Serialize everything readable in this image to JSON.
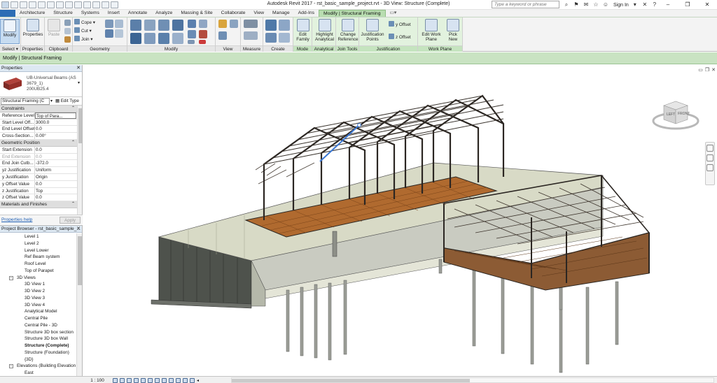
{
  "title_bar": {
    "title": "Autodesk Revit 2017 -    rst_basic_sample_project.rvt - 3D View: Structure (Complete)",
    "search_placeholder": "Type a keyword or phrase",
    "sign_in": "Sign In"
  },
  "ribbon_tabs": [
    "Architecture",
    "Structure",
    "Systems",
    "Insert",
    "Annotate",
    "Analyze",
    "Massing & Site",
    "Collaborate",
    "View",
    "Manage",
    "Add-Ins",
    "Modify | Structural Framing"
  ],
  "ribbon": {
    "select": {
      "modify_label": "Modify",
      "panel_label": "Select ▾"
    },
    "properties": {
      "button_label": "Properties",
      "panel_label": "Properties"
    },
    "clipboard": {
      "paste_label": "Paste",
      "panel_label": "Clipboard"
    },
    "geometry": {
      "cope_label": "Cope",
      "cut_label": "Cut",
      "join_label": "Join",
      "panel_label": "Geometry"
    },
    "modify": {
      "panel_label": "Modify"
    },
    "view": {
      "panel_label": "View"
    },
    "measure": {
      "panel_label": "Measure"
    },
    "create": {
      "panel_label": "Create"
    },
    "mode": {
      "edit_family_label": "Edit Family",
      "panel_label": "Mode"
    },
    "analytical": {
      "highlight_label": "Highlight Analytical",
      "panel_label": "Analytical"
    },
    "join_tools": {
      "change_ref_label": "Change Reference",
      "panel_label": "Join Tools"
    },
    "justification": {
      "points_label": "Justification Points",
      "y_offset_label": "y Offset",
      "z_offset_label": "z Offset",
      "panel_label": "Justification"
    },
    "work_plane": {
      "edit_label": "Edit Work Plane",
      "pick_label": "Pick New",
      "panel_label": "Work Plane"
    }
  },
  "context_bar": {
    "text": "Modify | Structural Framing"
  },
  "properties": {
    "header": "Properties",
    "type_name": "UB-Universal Beams (AS 3679_1)",
    "type_size": "200UB25.4",
    "filter": "Structural Framing (C",
    "edit_type": "Edit Type",
    "groups": {
      "constraints": "Constraints",
      "geometric_position": "Geometric Position",
      "materials": "Materials and Finishes"
    },
    "constraints_rows": [
      {
        "name": "Reference Level",
        "value": "Top of Para..."
      },
      {
        "name": "Start Level Off...",
        "value": "3000.0"
      },
      {
        "name": "End Level Offset",
        "value": "0.0"
      },
      {
        "name": "Cross-Section...",
        "value": "0.00°"
      }
    ],
    "geometry_rows": [
      {
        "name": "Start Extension",
        "value": "0.0"
      },
      {
        "name": "End Extension",
        "value": "0.0"
      },
      {
        "name": "End Join Cutb...",
        "value": "-372.0"
      },
      {
        "name": "yz Justification",
        "value": "Uniform"
      },
      {
        "name": "y Justification",
        "value": "Origin"
      },
      {
        "name": "y Offset Value",
        "value": "0.0"
      },
      {
        "name": "z Justification",
        "value": "Top"
      },
      {
        "name": "z Offset Value",
        "value": "0.0"
      }
    ],
    "help_link": "Properties help",
    "apply_label": "Apply"
  },
  "project_browser": {
    "header": "Project Browser - rst_basic_sample_...",
    "items": [
      {
        "label": "Level 1",
        "level": 2,
        "bold": false
      },
      {
        "label": "Level 2",
        "level": 2,
        "bold": false
      },
      {
        "label": "Level Lower",
        "level": 2,
        "bold": false
      },
      {
        "label": "Ref Beam system",
        "level": 2,
        "bold": false
      },
      {
        "label": "Roof Level",
        "level": 2,
        "bold": false
      },
      {
        "label": "Top of Parapet",
        "level": 2,
        "bold": false
      },
      {
        "label": "3D Views",
        "level": 1,
        "bold": false
      },
      {
        "label": "3D View 1",
        "level": 2,
        "bold": false
      },
      {
        "label": "3D View 2",
        "level": 2,
        "bold": false
      },
      {
        "label": "3D View 3",
        "level": 2,
        "bold": false
      },
      {
        "label": "3D View 4",
        "level": 2,
        "bold": false
      },
      {
        "label": "Analytical Model",
        "level": 2,
        "bold": false
      },
      {
        "label": "Central Pile",
        "level": 2,
        "bold": false
      },
      {
        "label": "Central Pile - 3D",
        "level": 2,
        "bold": false
      },
      {
        "label": "Structure 3D box section",
        "level": 2,
        "bold": false
      },
      {
        "label": "Structure 3D box Wall",
        "level": 2,
        "bold": false
      },
      {
        "label": "Structure (Complete)",
        "level": 2,
        "bold": true
      },
      {
        "label": "Structure (Foundation)",
        "level": 2,
        "bold": false
      },
      {
        "label": "{3D}",
        "level": 2,
        "bold": false
      },
      {
        "label": "Elevations (Building Elevation",
        "level": 1,
        "bold": false
      },
      {
        "label": "East",
        "level": 2,
        "bold": false
      }
    ]
  },
  "view_cube": {
    "left_face": "LEFT",
    "front_face": "FRONT"
  },
  "status_bar": {
    "scale": "1 : 100"
  },
  "colors": {
    "context_tab": "#b8ddb0",
    "context_bar": "#c9e3c2",
    "steel": "#2b2622",
    "timber": "#b06a2f",
    "concrete": "#d8dac6",
    "wall_dark": "#4e524c"
  }
}
